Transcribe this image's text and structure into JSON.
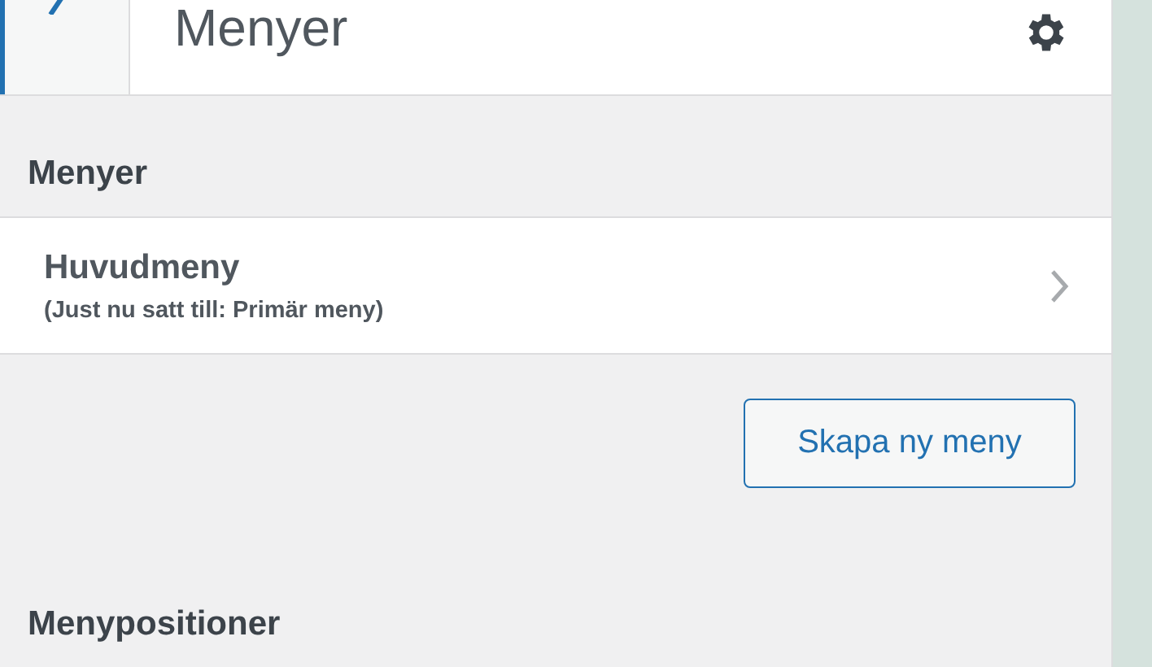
{
  "header": {
    "title": "Menyer"
  },
  "section": {
    "title": "Menyer"
  },
  "menus": [
    {
      "name": "Huvudmeny",
      "description": "(Just nu satt till: Primär meny)"
    }
  ],
  "create_button": "Skapa ny meny",
  "next_section": {
    "title": "Menypositioner"
  }
}
